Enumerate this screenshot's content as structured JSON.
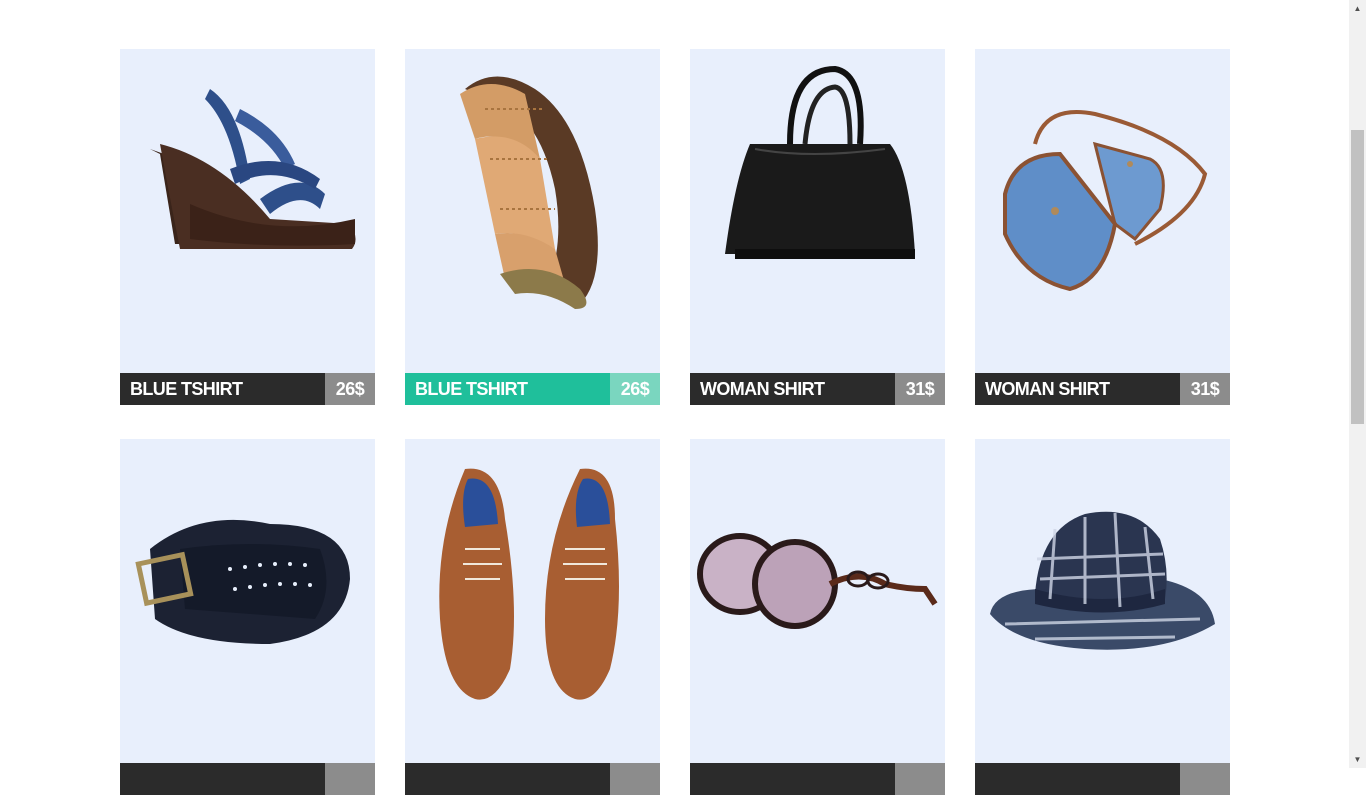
{
  "products": [
    {
      "name": "BLUE TSHIRT",
      "price": "26$",
      "image": "high-heel-sandal",
      "active": false
    },
    {
      "name": "BLUE TSHIRT",
      "price": "26$",
      "image": "braided-belt",
      "active": true
    },
    {
      "name": "WOMAN SHIRT",
      "price": "31$",
      "image": "black-handbag",
      "active": false
    },
    {
      "name": "WOMAN SHIRT",
      "price": "31$",
      "image": "denim-shoulder-bag",
      "active": false
    },
    {
      "name": "",
      "price": "",
      "image": "perforated-belt",
      "active": false
    },
    {
      "name": "",
      "price": "",
      "image": "brown-oxford-shoes",
      "active": false
    },
    {
      "name": "",
      "price": "",
      "image": "sunglasses",
      "active": false
    },
    {
      "name": "",
      "price": "",
      "image": "plaid-fedora-hat",
      "active": false
    }
  ],
  "colors": {
    "card_bg": "#e8effc",
    "bar_dark": "#2b2b2b",
    "price_grey": "#8c8c8c",
    "accent": "#1fbf9b",
    "accent_light": "#7ad6bf"
  },
  "scrollbar": {
    "up_icon": "arrow-up-icon",
    "down_icon": "arrow-down-icon"
  }
}
